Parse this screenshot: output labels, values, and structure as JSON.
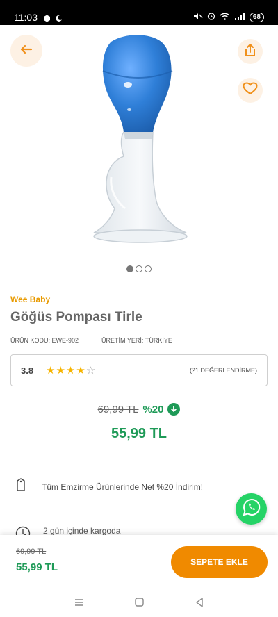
{
  "status_bar": {
    "time": "11:03",
    "battery": "68",
    "icons": [
      "box-icon",
      "moon-icon",
      "alarm-icon",
      "wifi-icon",
      "signal-icon"
    ]
  },
  "header_actions": {
    "back_icon": "arrow-left-icon",
    "share_icon": "share-icon",
    "favorite_icon": "heart-icon"
  },
  "product": {
    "brand": "Wee Baby",
    "title": "Göğüs Pompası Tirle",
    "code_label": "ÜRÜN KODU:",
    "code_value": "EWE-902",
    "origin_label": "ÜRETİM YERİ:",
    "origin_value": "TÜRKİYE",
    "image_count": 3,
    "active_image": 1,
    "image_colors": {
      "bulb": "#2f7fd8",
      "funnel": "#e9eef3"
    }
  },
  "rating": {
    "score": "3.8",
    "stars_full": 4,
    "stars_total": 5,
    "review_count": "(21 DEĞERLENDİRME)"
  },
  "pricing": {
    "old_price": "69,99 TL",
    "discount": "%20",
    "new_price": "55,99 TL",
    "accent_color": "#1e9a57"
  },
  "promo": {
    "text": "Tüm Emzirme Ürünlerinde Net %20 İndirim!",
    "icon": "tag-icon"
  },
  "delivery": {
    "text": "2 gün içinde kargoda",
    "icon": "clock-icon"
  },
  "bottom_bar": {
    "old_price": "69,99 TL",
    "new_price": "55,99 TL",
    "add_to_cart": "SEPETE EKLE",
    "button_color": "#f08a00"
  },
  "nav_bar": {
    "items": [
      "menu-icon",
      "home-icon",
      "back-nav-icon"
    ]
  }
}
